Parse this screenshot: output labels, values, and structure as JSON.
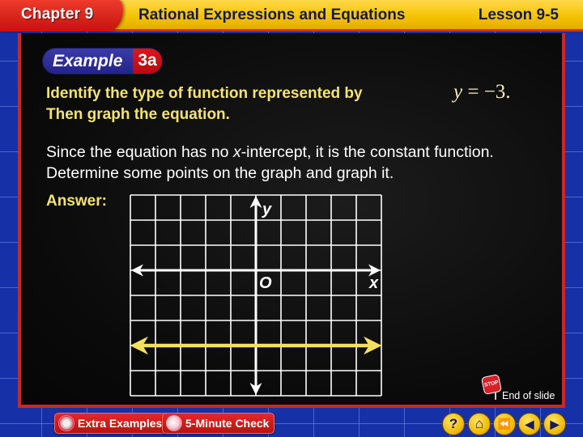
{
  "header": {
    "chapter": "Chapter 9",
    "title": "Rational Expressions and Equations",
    "lesson": "Lesson 9-5"
  },
  "example": {
    "word": "Example",
    "number": "3a"
  },
  "question": {
    "line1": "Identify the type of function represented by",
    "line2": "Then graph the equation.",
    "equation_var": "y",
    "equation_rest": " = −3."
  },
  "explanation": {
    "part1": "Since the equation has no ",
    "italic": "x",
    "part2": "-intercept, it is the constant function. Determine some points on the graph and graph it."
  },
  "answer_label": "Answer:",
  "graph": {
    "x_label": "x",
    "y_label": "y",
    "origin_label": "O",
    "columns": 10,
    "rows": 8,
    "x_range": [
      -5,
      5
    ],
    "y_range": [
      -5,
      3
    ],
    "line_y": -3,
    "line_color": "#f4e060",
    "grid_color": "#ffffff"
  },
  "end_of_slide": {
    "stop_text": "STOP",
    "label": "End of slide"
  },
  "bottom_buttons": {
    "extra_examples": "Extra Examples",
    "five_minute_check": "5-Minute Check"
  },
  "nav_buttons": [
    {
      "name": "help",
      "glyph": "?"
    },
    {
      "name": "home",
      "glyph": "⌂"
    },
    {
      "name": "first",
      "glyph": "⏪"
    },
    {
      "name": "previous",
      "glyph": "◀"
    },
    {
      "name": "next",
      "glyph": "▶"
    }
  ]
}
